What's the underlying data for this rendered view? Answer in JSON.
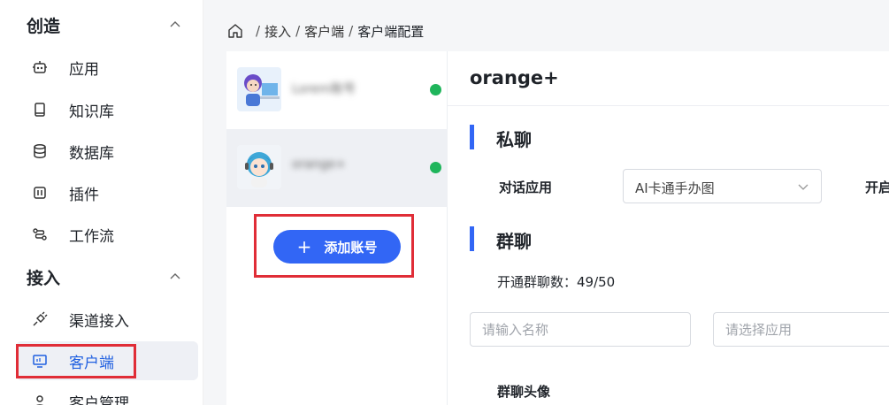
{
  "sidebar": {
    "groups": [
      {
        "title": "创造",
        "items": [
          {
            "label": "应用",
            "icon": "robot-icon"
          },
          {
            "label": "知识库",
            "icon": "book-icon"
          },
          {
            "label": "数据库",
            "icon": "database-icon"
          },
          {
            "label": "插件",
            "icon": "plugin-icon"
          },
          {
            "label": "工作流",
            "icon": "workflow-icon"
          }
        ]
      },
      {
        "title": "接入",
        "items": [
          {
            "label": "渠道接入",
            "icon": "plug-icon"
          },
          {
            "label": "客户端",
            "icon": "monitor-icon",
            "active": true
          },
          {
            "label": "客户管理",
            "icon": "user-icon"
          }
        ]
      }
    ]
  },
  "breadcrumb": {
    "items": [
      "接入",
      "客户端",
      "客户端配置"
    ],
    "separator": "/"
  },
  "accounts": {
    "items": [
      {
        "name": "Lorem账号",
        "status": "online"
      },
      {
        "name": "orange+",
        "status": "online"
      }
    ],
    "add_button_label": "添加账号",
    "add_button_icon": "plus-icon"
  },
  "config": {
    "title": "orange+",
    "private_chat": {
      "title": "私聊",
      "app_label": "对话应用",
      "app_value": "AI卡通手办图",
      "trailing_label": "开启"
    },
    "group_chat": {
      "title": "群聊",
      "count_text": "开通群聊数：49/50",
      "name_placeholder": "请输入名称",
      "app_placeholder": "请选择应用",
      "avatar_label": "群聊头像"
    }
  },
  "colors": {
    "accent": "#3266f5",
    "highlight": "#e02d37",
    "online": "#1fb55b"
  }
}
